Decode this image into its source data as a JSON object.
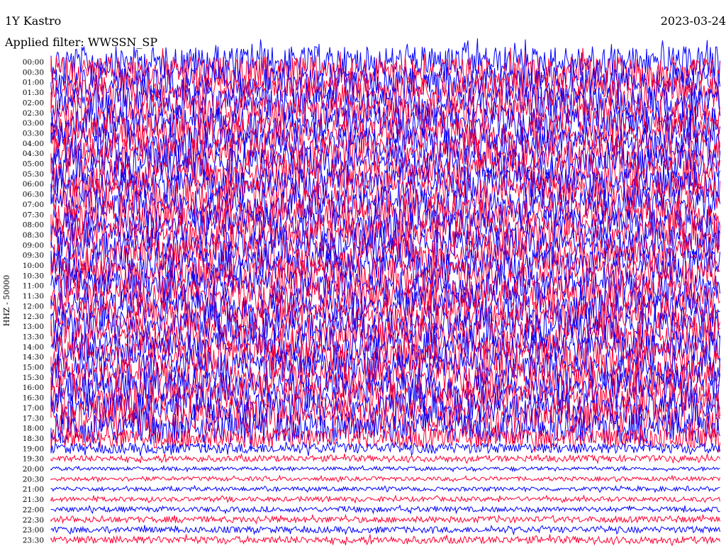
{
  "header": {
    "station": "1Y Kastro",
    "date": "2023-03-24",
    "filter": "Applied filter: WWSSN_SP"
  },
  "axis": {
    "ylabel": "HHZ - 50000"
  },
  "colors": {
    "trace_a": "#0000ff",
    "trace_b": "#ff0033",
    "background": "#ffffff"
  },
  "chart_data": {
    "type": "heliplot",
    "ylabel": "HHZ - 50000",
    "row_labels": [
      "00:00",
      "00:30",
      "01:00",
      "01:30",
      "02:00",
      "02:30",
      "03:00",
      "03:30",
      "04:00",
      "04:30",
      "05:00",
      "05:30",
      "06:00",
      "06:30",
      "07:00",
      "07:30",
      "08:00",
      "08:30",
      "09:00",
      "09:30",
      "10:00",
      "10:30",
      "11:00",
      "11:30",
      "12:00",
      "12:30",
      "13:00",
      "13:30",
      "14:00",
      "14:30",
      "15:00",
      "15:30",
      "16:00",
      "16:30",
      "17:00",
      "17:30",
      "18:00",
      "18:30",
      "19:00",
      "19:30",
      "20:00",
      "20:30",
      "21:00",
      "21:30",
      "22:00",
      "22:30",
      "23:00",
      "23:30"
    ],
    "series": [
      {
        "color": "#0000ff"
      },
      {
        "color": "#ff0033"
      }
    ],
    "relative_amplitude": [
      3.0,
      3.0,
      3.0,
      3.0,
      3.0,
      3.0,
      3.0,
      3.0,
      3.0,
      3.0,
      3.0,
      3.0,
      3.0,
      3.0,
      3.0,
      3.0,
      3.0,
      3.0,
      3.0,
      3.0,
      3.0,
      3.0,
      3.0,
      3.0,
      3.0,
      3.0,
      3.0,
      3.0,
      3.0,
      3.0,
      3.0,
      3.0,
      3.0,
      3.0,
      3.0,
      3.0,
      3.0,
      2.0,
      1.0,
      0.6,
      0.35,
      0.4,
      0.4,
      0.45,
      0.5,
      0.6,
      0.6,
      0.7
    ]
  }
}
